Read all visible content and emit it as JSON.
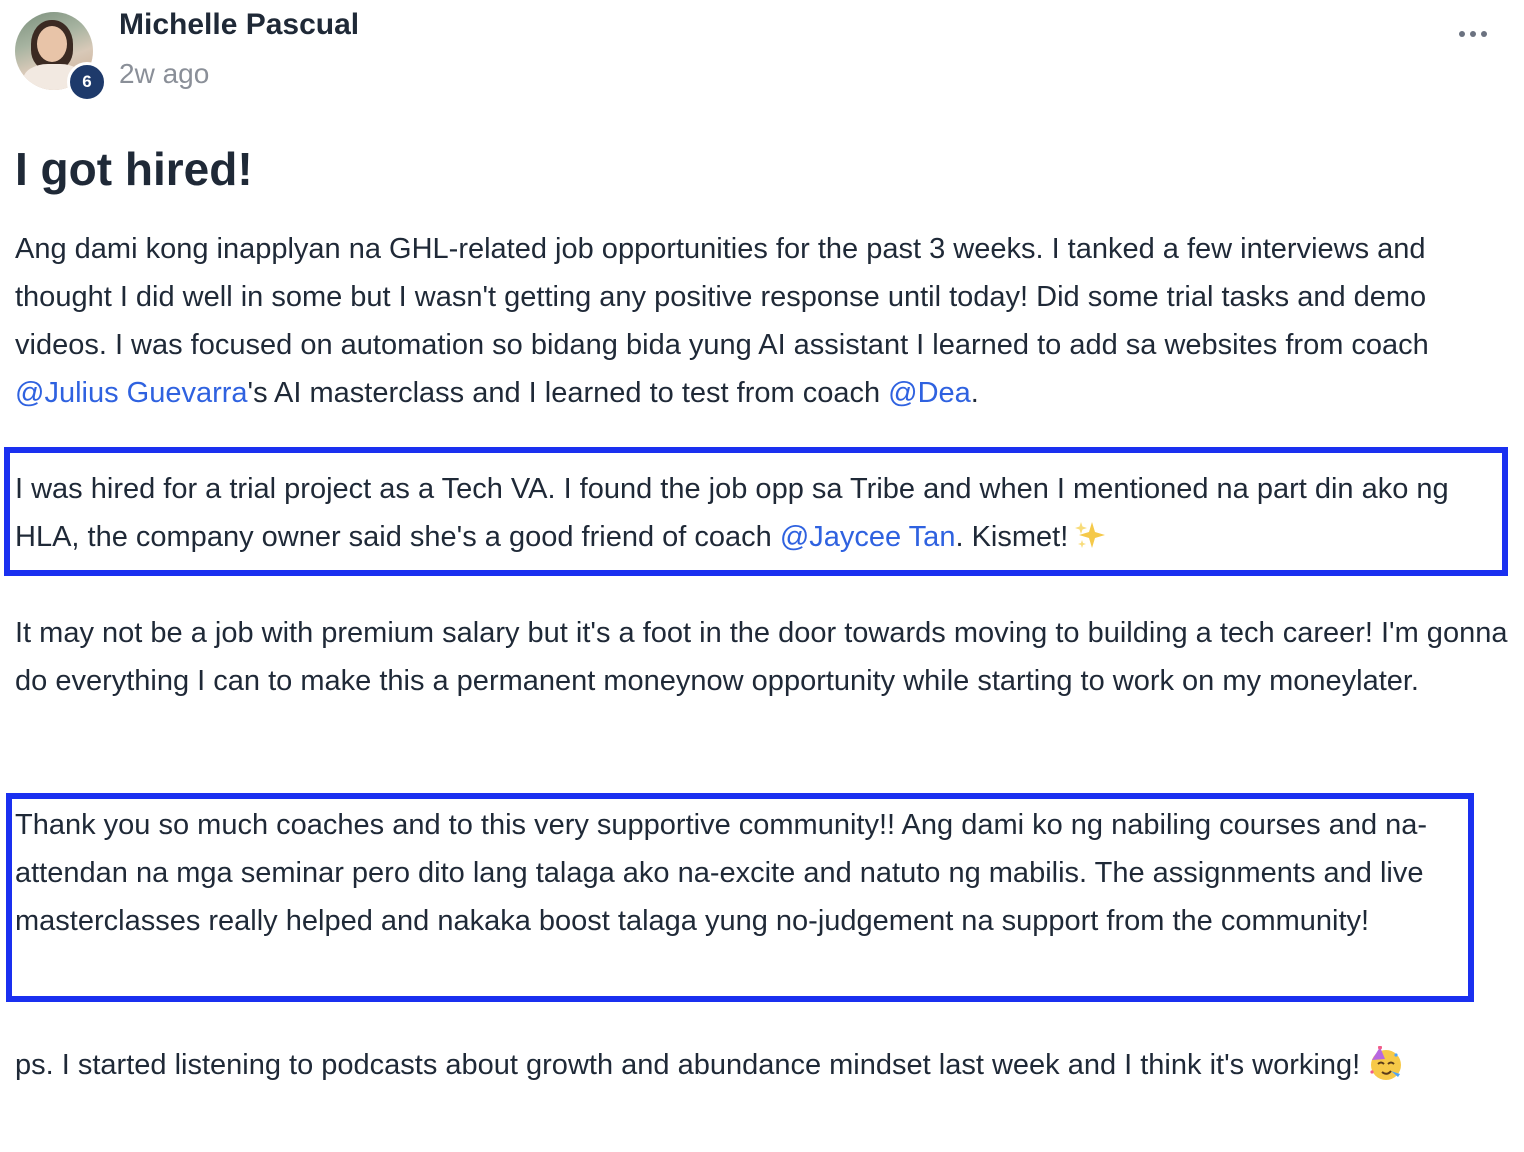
{
  "author": {
    "name": "Michelle Pascual",
    "level": "6",
    "timestamp": "2w ago"
  },
  "post": {
    "title": "I got hired!",
    "p1": {
      "text_a": "Ang dami kong inapplyan na GHL-related job opportunities for the past 3 weeks. I tanked a few interviews and thought I did well in some but I wasn't getting any positive response until today! Did some trial tasks and demo videos. I was focused on automation so bidang bida yung AI assistant I learned to add sa websites from coach ",
      "mention_1": "@Julius Guevarra",
      "text_b": "'s AI masterclass and I learned to test from coach ",
      "mention_2": "@Dea",
      "text_c": "."
    },
    "p2": {
      "text_a": "I was hired for a trial project as a Tech VA. I found the job opp sa Tribe and when I mentioned na part din ako ng HLA, the company owner said she's a good friend of coach ",
      "mention_1": "@Jaycee Tan",
      "text_b": ". Kismet!"
    },
    "p3": "It may not be a job with premium salary but it's a foot in the door towards moving to building a tech career! I'm gonna do everything I can to make this a permanent moneynow opportunity while starting to work on my moneylater.",
    "p4": "Thank you so much coaches and to this very supportive community!! Ang dami ko ng nabiling courses and na-attendan na mga seminar pero dito lang talaga ako na-excite and natuto ng mabilis. The assignments and live masterclasses really helped and nakaka boost talaga yung no-judgement na support from the community!",
    "p5": "ps. I started listening to podcasts about growth and abundance mindset last week and I think it's working!"
  },
  "icons": {
    "more": "more-horizontal-icon",
    "sparkles": "sparkles-icon",
    "party_face": "partying-face-icon"
  },
  "colors": {
    "mention": "#2f62e0",
    "highlight_border": "#1a30f0",
    "level_badge": "#1e3a6b"
  }
}
